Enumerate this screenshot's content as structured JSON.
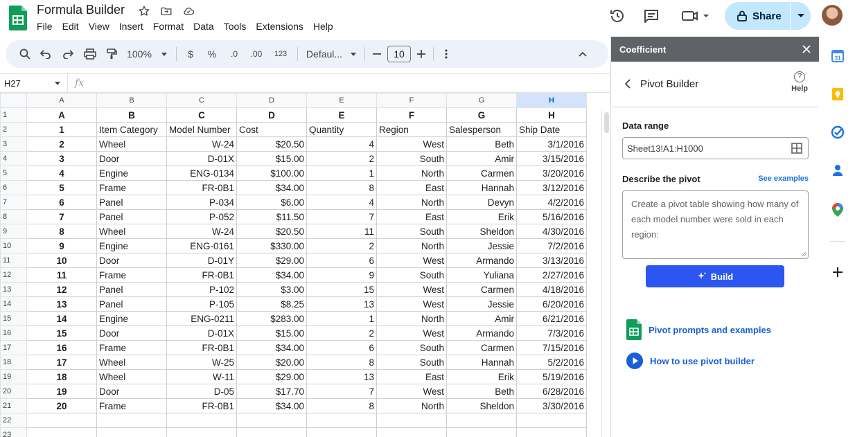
{
  "document": {
    "title": "Formula Builder",
    "menu": [
      "File",
      "Edit",
      "View",
      "Insert",
      "Format",
      "Data",
      "Tools",
      "Extensions",
      "Help"
    ]
  },
  "header": {
    "share_label": "Share"
  },
  "toolbar": {
    "zoom": "100%",
    "currency": "$",
    "percent": "%",
    "decrease_decimal": ".0",
    "increase_decimal": ".00",
    "format_123": "123",
    "font": "Defaul...",
    "font_size": "10"
  },
  "formula_bar": {
    "cell_ref": "H27",
    "fx": "fx"
  },
  "grid": {
    "columns": [
      "A",
      "B",
      "C",
      "D",
      "E",
      "F",
      "G",
      "H"
    ],
    "selected_column": "H",
    "rows": [
      [
        "A",
        "B",
        "C",
        "D",
        "E",
        "F",
        "G",
        "H"
      ],
      [
        "1",
        "Item Category",
        "Model Number",
        "Cost",
        "Quantity",
        "Region",
        "Salesperson",
        "Ship Date"
      ],
      [
        "2",
        "Wheel",
        "W-24",
        "$20.50",
        "4",
        "West",
        "Beth",
        "3/1/2016"
      ],
      [
        "3",
        "Door",
        "D-01X",
        "$15.00",
        "2",
        "South",
        "Amir",
        "3/15/2016"
      ],
      [
        "4",
        "Engine",
        "ENG-0134",
        "$100.00",
        "1",
        "North",
        "Carmen",
        "3/20/2016"
      ],
      [
        "5",
        "Frame",
        "FR-0B1",
        "$34.00",
        "8",
        "East",
        "Hannah",
        "3/12/2016"
      ],
      [
        "6",
        "Panel",
        "P-034",
        "$6.00",
        "4",
        "North",
        "Devyn",
        "4/2/2016"
      ],
      [
        "7",
        "Panel",
        "P-052",
        "$11.50",
        "7",
        "East",
        "Erik",
        "5/16/2016"
      ],
      [
        "8",
        "Wheel",
        "W-24",
        "$20.50",
        "11",
        "South",
        "Sheldon",
        "4/30/2016"
      ],
      [
        "9",
        "Engine",
        "ENG-0161",
        "$330.00",
        "2",
        "North",
        "Jessie",
        "7/2/2016"
      ],
      [
        "10",
        "Door",
        "D-01Y",
        "$29.00",
        "6",
        "West",
        "Armando",
        "3/13/2016"
      ],
      [
        "11",
        "Frame",
        "FR-0B1",
        "$34.00",
        "9",
        "South",
        "Yuliana",
        "2/27/2016"
      ],
      [
        "12",
        "Panel",
        "P-102",
        "$3.00",
        "15",
        "West",
        "Carmen",
        "4/18/2016"
      ],
      [
        "13",
        "Panel",
        "P-105",
        "$8.25",
        "13",
        "West",
        "Jessie",
        "6/20/2016"
      ],
      [
        "14",
        "Engine",
        "ENG-0211",
        "$283.00",
        "1",
        "North",
        "Amir",
        "6/21/2016"
      ],
      [
        "15",
        "Door",
        "D-01X",
        "$15.00",
        "2",
        "West",
        "Armando",
        "7/3/2016"
      ],
      [
        "16",
        "Frame",
        "FR-0B1",
        "$34.00",
        "6",
        "South",
        "Carmen",
        "7/15/2016"
      ],
      [
        "17",
        "Wheel",
        "W-25",
        "$20.00",
        "8",
        "South",
        "Hannah",
        "5/2/2016"
      ],
      [
        "18",
        "Wheel",
        "W-11",
        "$29.00",
        "13",
        "East",
        "Erik",
        "5/19/2016"
      ],
      [
        "19",
        "Door",
        "D-05",
        "$17.70",
        "7",
        "West",
        "Beth",
        "6/28/2016"
      ],
      [
        "20",
        "Frame",
        "FR-0B1",
        "$34.00",
        "8",
        "North",
        "Sheldon",
        "3/30/2016"
      ],
      [
        "",
        "",
        "",
        "",
        "",
        "",
        "",
        ""
      ],
      [
        "",
        "",
        "",
        "",
        "",
        "",
        "",
        ""
      ]
    ]
  },
  "sidebar": {
    "app_name": "Coefficient",
    "title": "Pivot Builder",
    "help_label": "Help",
    "data_range_label": "Data range",
    "data_range_value": "Sheet13!A1:H1000",
    "describe_label": "Describe the pivot",
    "see_examples": "See examples",
    "describe_text": "Create a pivot table showing how many of each model number were sold in each region:",
    "build_label": "Build",
    "link_prompts": "Pivot prompts and examples",
    "link_howto": "How to use pivot builder"
  },
  "colors": {
    "accent": "#2c56f1",
    "share_bg": "#c2e7ff",
    "sheets_green": "#0f9d58",
    "panel_header": "#5f6368"
  }
}
